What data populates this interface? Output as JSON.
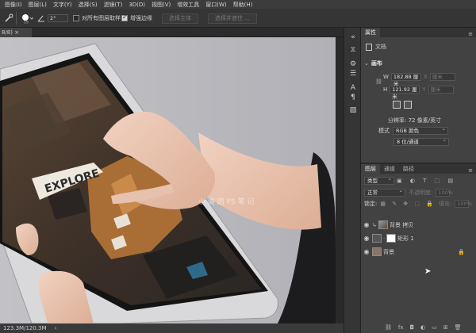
{
  "menubar": {
    "items": [
      "图像(I)",
      "图层(L)",
      "文字(Y)",
      "选择(S)",
      "滤镜(T)",
      "3D(D)",
      "视图(V)",
      "增效工具",
      "窗口(W)",
      "帮助(H)"
    ]
  },
  "options": {
    "angle_value": "2°",
    "sample_all_label": "对所有图层取样",
    "auto_enhance_label": "增强边缘",
    "select_subject_label": "选择主体",
    "select_mask_label": "选择并遮住 ..."
  },
  "document": {
    "tab_label": "8/8) ×"
  },
  "canvas": {
    "sign_text": "EXPLORE",
    "watermark": "小 渝 的 PS 笔 记"
  },
  "status": {
    "doc_size": "123.3M/120.3M"
  },
  "properties": {
    "tabs": [
      "属性"
    ],
    "doc_type_label": "文档",
    "canvas_label": "画布",
    "w_label": "W",
    "w_value": "182.88 厘米",
    "x_label": "X",
    "x_value": "厘米",
    "h_label": "H",
    "h_value": "121.92 厘米",
    "y_label": "Y",
    "y_value": "厘米",
    "resolution": "分辨率: 72 像素/英寸",
    "mode_label": "模式",
    "mode_value": "RGB 颜色",
    "depth_value": "8 位/通道"
  },
  "layers": {
    "tabs": [
      "图层",
      "通道",
      "路径"
    ],
    "filter_type": "类型",
    "blend_mode": "正常",
    "opacity_label": "不透明度:",
    "opacity_value": "100%",
    "lock_label": "锁定:",
    "fill_label": "填充:",
    "fill_value": "100%",
    "items": [
      {
        "name": "背景 拷贝"
      },
      {
        "name": "矩形 1"
      },
      {
        "name": "背景"
      }
    ]
  },
  "colors": {
    "accent": "#3d6bc9",
    "panel_bg": "#424242",
    "canvas_bg": "#b9b9bd"
  }
}
